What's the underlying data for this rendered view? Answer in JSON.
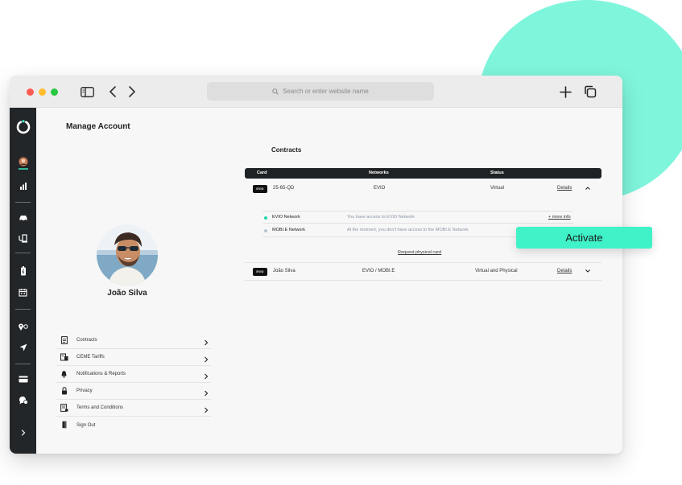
{
  "browser": {
    "address_placeholder": "Search or enter website name"
  },
  "page": {
    "title": "Manage Account"
  },
  "user": {
    "name": "João Silva"
  },
  "menu": {
    "items": [
      {
        "label": "Contracts",
        "icon": "document-icon"
      },
      {
        "label": "CEME Tariffs",
        "icon": "tariff-icon"
      },
      {
        "label": "Notifications & Reports",
        "icon": "bell-icon"
      },
      {
        "label": "Privacy",
        "icon": "lock-icon"
      },
      {
        "label": "Terms and Conditions",
        "icon": "terms-icon"
      },
      {
        "label": "Sign Out",
        "icon": "exit-icon"
      }
    ]
  },
  "contracts": {
    "title": "Contracts",
    "headers": {
      "card": "Card",
      "networks": "Networks",
      "status": "Status"
    },
    "rows": [
      {
        "card_logo": "EVIO",
        "card_id": "25-65-QD",
        "networks": "EVIO",
        "status": "Virtual",
        "details": "Details",
        "expanded": true,
        "sub_rows": [
          {
            "network": "EVIO Network",
            "message": "You have access to EVIO Network",
            "action": "+ more info",
            "dot_color": "#23d6ab"
          },
          {
            "network": "MOBI.E Network",
            "message": "At the moment, you don't have access to the MOBI.E Network",
            "action": "",
            "dot_color": "#b9c2d0"
          }
        ],
        "request_card": "Request physical card"
      },
      {
        "card_logo": "EVIO",
        "card_id": "João Silva",
        "networks": "EVIO / MOBI.E",
        "status": "Virtual and Physical",
        "details": "Details",
        "expanded": false
      }
    ]
  },
  "activate_button": {
    "label": "Activate"
  },
  "colors": {
    "accent": "#3ff2c8",
    "blob": "#7ff5dc",
    "sidebar": "#232628",
    "table_header": "#1f2224"
  }
}
